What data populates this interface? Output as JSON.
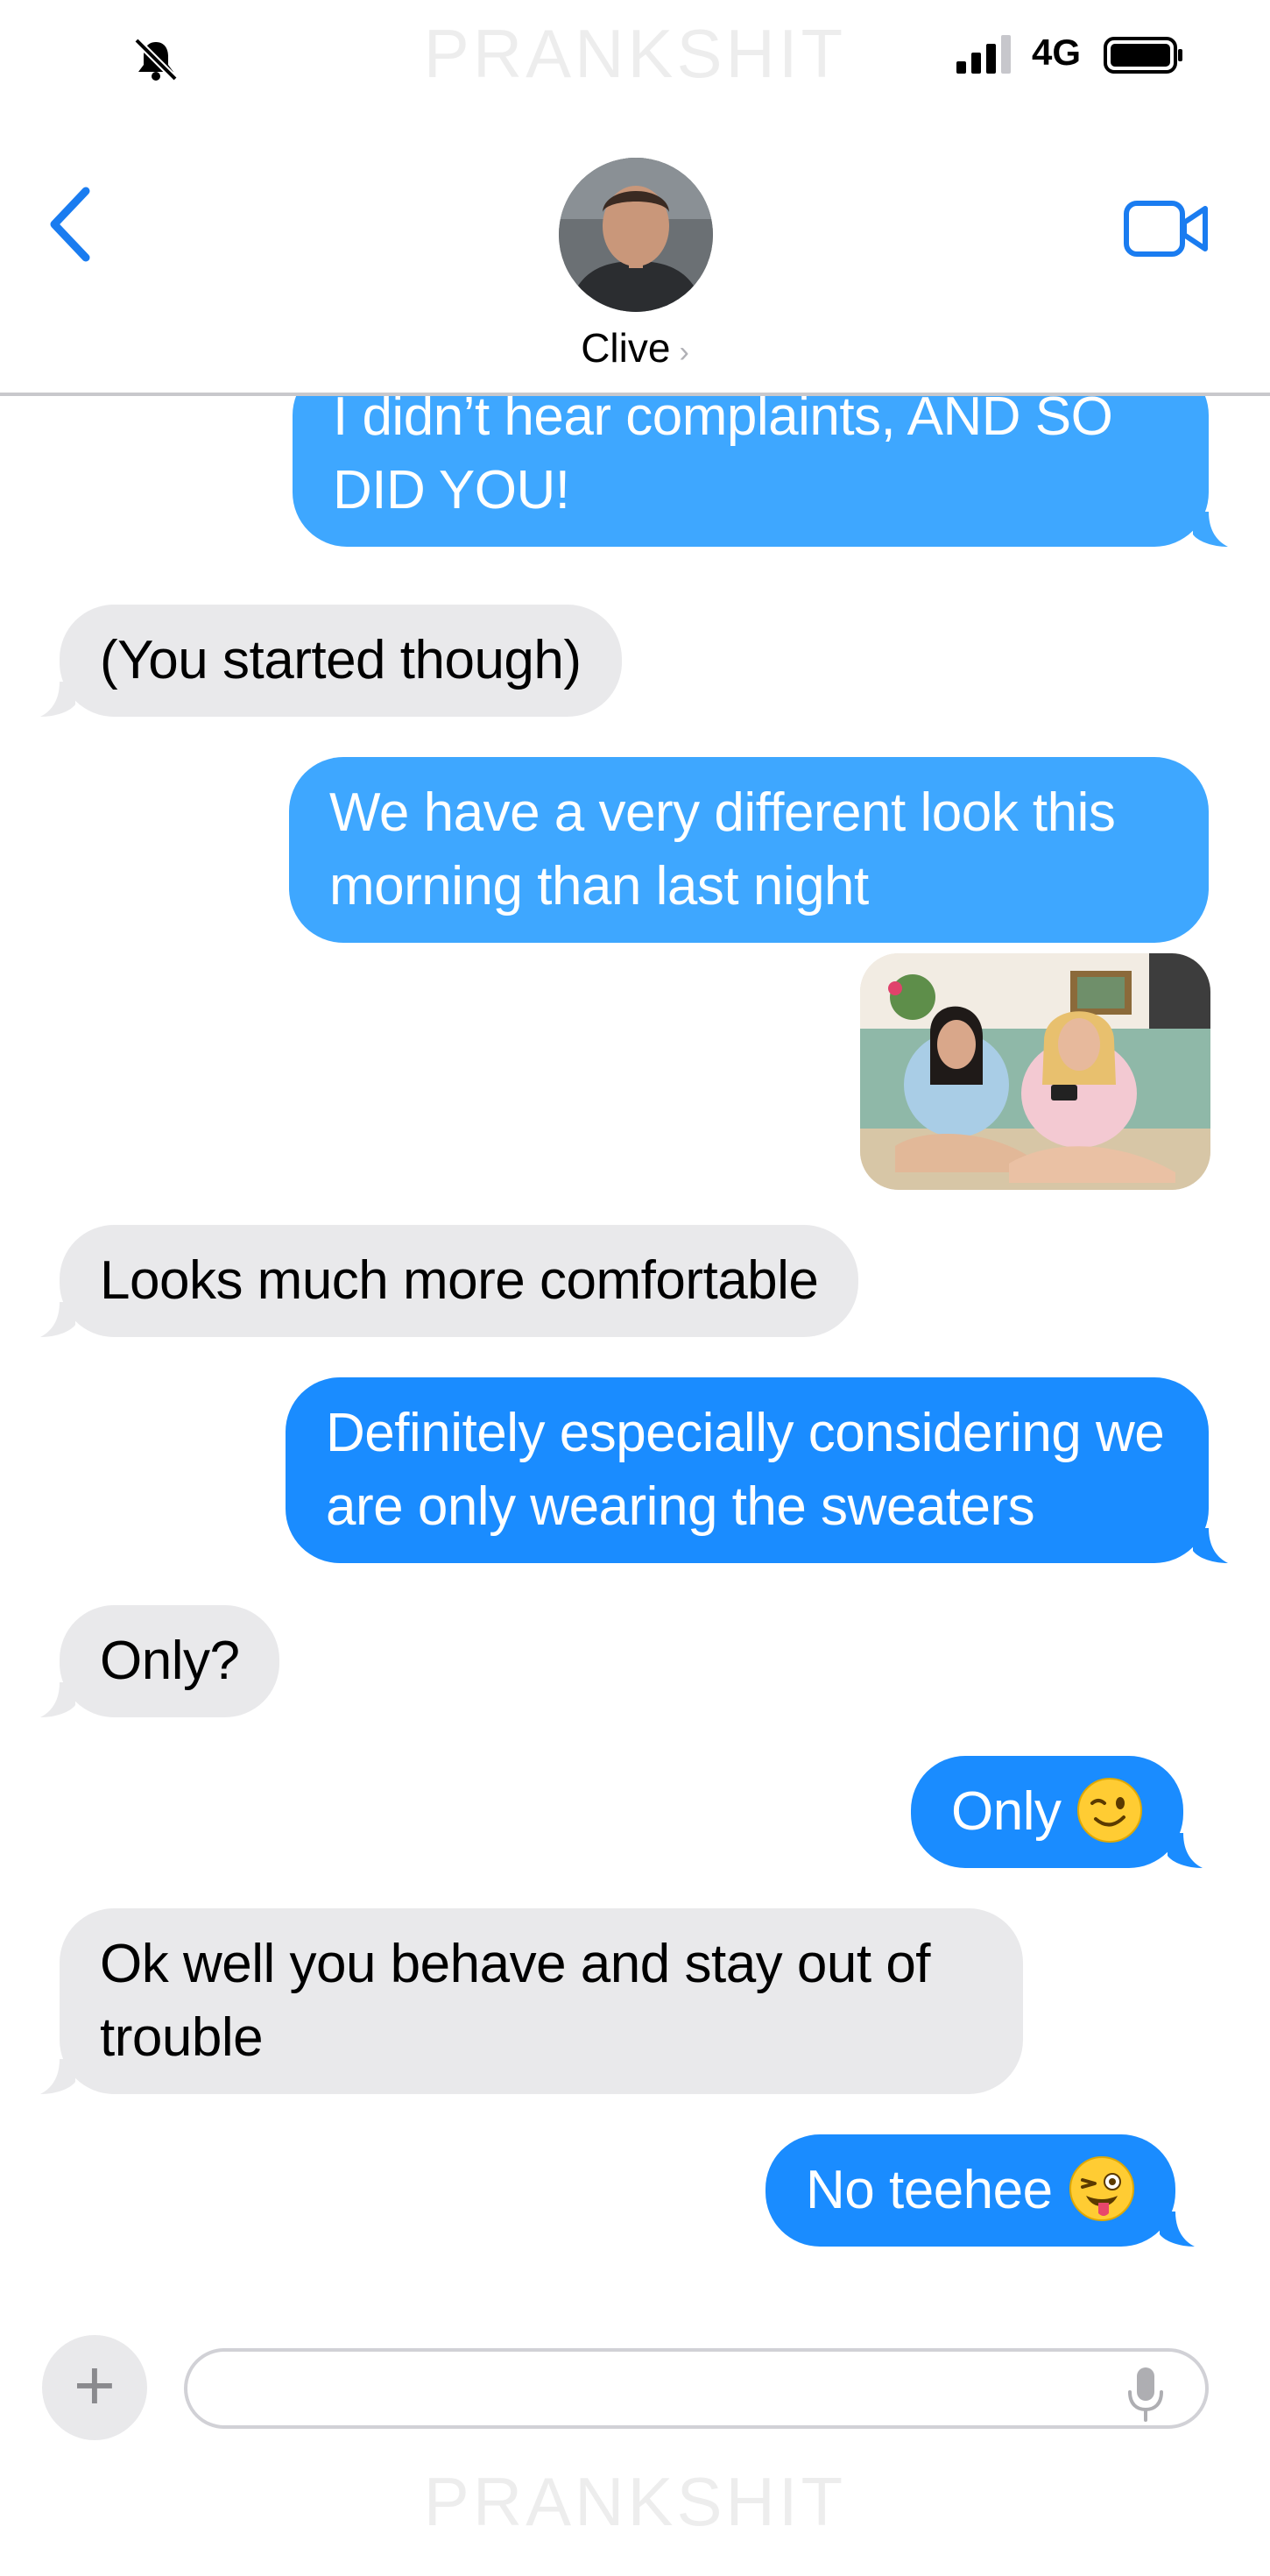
{
  "status_bar": {
    "watermark": "PRANKSHIT",
    "network": "4G"
  },
  "header": {
    "contact_name": "Clive",
    "chevron": "›"
  },
  "messages": [
    {
      "direction": "sent",
      "text": "I didn’t hear complaints, AND SO DID YOU!"
    },
    {
      "direction": "received",
      "text": "(You started though)"
    },
    {
      "direction": "sent",
      "text": "We have a very different look this morning than last night"
    },
    {
      "direction": "sent",
      "type": "photo",
      "text": ""
    },
    {
      "direction": "received",
      "text": "Looks much more comfortable"
    },
    {
      "direction": "sent",
      "text": "Definitely especially considering we are only wearing the sweaters"
    },
    {
      "direction": "received",
      "text": "Only?"
    },
    {
      "direction": "sent",
      "text": "Only",
      "emoji": "winking-face"
    },
    {
      "direction": "received",
      "text": "Ok well you behave and stay out of trouble"
    },
    {
      "direction": "sent",
      "text": "No teehee",
      "emoji": "winking-face-with-tongue"
    }
  ],
  "composer": {
    "plus_label": "+",
    "input_value": "",
    "input_placeholder": ""
  },
  "footer": {
    "watermark": "PRANKSHIT"
  },
  "colors": {
    "sent_bubble": "#1a8cff",
    "received_bubble": "#e9e9eb",
    "accent": "#1a7cf0"
  }
}
